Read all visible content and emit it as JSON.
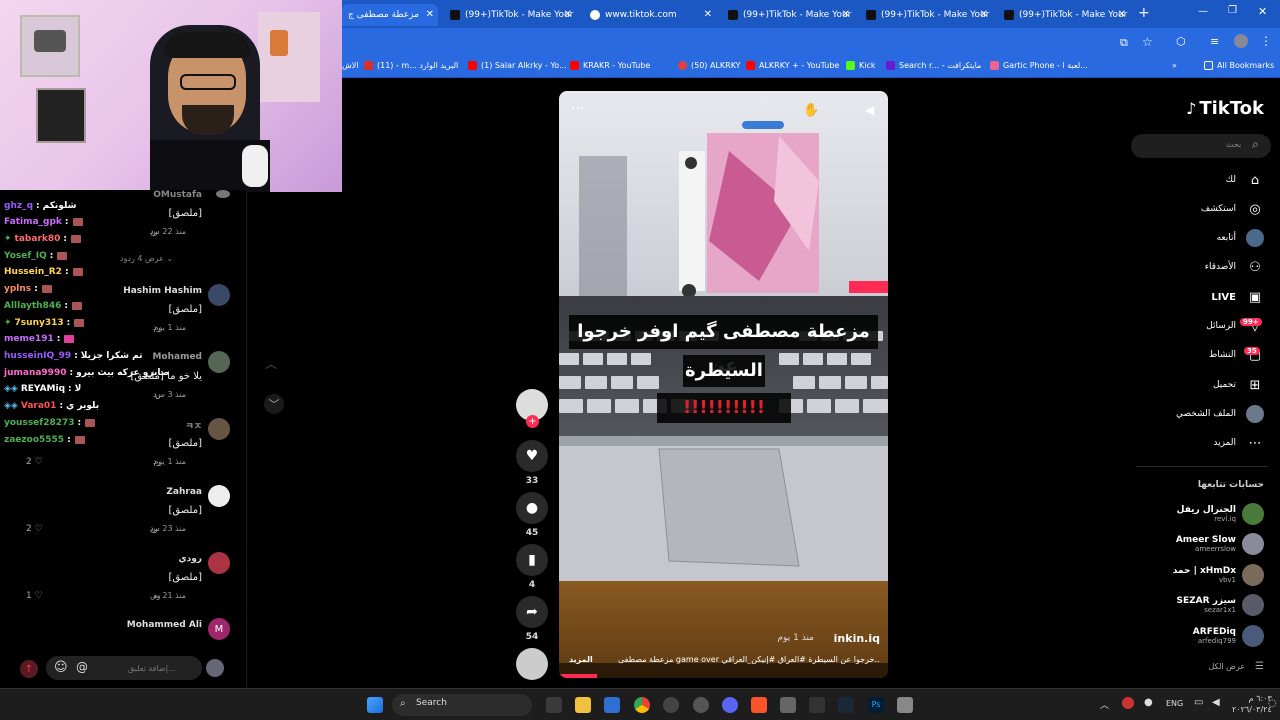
{
  "browser": {
    "tabs": [
      {
        "label": "مزعطة مصطفى ج",
        "active": true
      },
      {
        "label": "(99+)TikTok - Make Your"
      },
      {
        "label": "www.tiktok.com"
      },
      {
        "label": "(99+)TikTok - Make Your"
      },
      {
        "label": "(99+)TikTok - Make Your"
      },
      {
        "label": "(99+)TikTok - Make Your"
      }
    ],
    "new_tab": "+",
    "bookmarks": [
      {
        "label": "(11) - m... البريد الوارد",
        "color": "#d93025"
      },
      {
        "label": "(1) Salar Alkrky - Yo...",
        "color": "#ff0000"
      },
      {
        "label": "KRAKR - YouTube",
        "color": "#ff0000"
      },
      {
        "label": "(50) ALKRKY",
        "color": "#e04040"
      },
      {
        "label": "ALKRKY + - YouTube",
        "color": "#ff0000"
      },
      {
        "label": "Kick",
        "color": "#53fc18"
      },
      {
        "label": "Search r... - مايتكرافت",
        "color": "#6a1bd1"
      },
      {
        "label": "Gartic Phone - لعبة ا...",
        "color": "#f06292"
      }
    ],
    "bookmarks_more": "»",
    "all_bookmarks": "All Bookmarks",
    "bookmark_left_partial": "الاش"
  },
  "chat": {
    "top_partial_name": "OMustafa",
    "lines": [
      {
        "user": "ghz_q",
        "msg": "شلونكم",
        "color": "#9b59ff"
      },
      {
        "user": "Fatima_gpk",
        "msg": "",
        "color": "#c86bff"
      },
      {
        "user": "tabark80",
        "msg": "",
        "color": "#ff6b6b"
      },
      {
        "user": "Yosef_IQ",
        "msg": "",
        "color": "#4caf50"
      },
      {
        "user": "Hussein_R2",
        "msg": "",
        "color": "#ffd54f"
      },
      {
        "user": "yplns",
        "msg": "",
        "color": "#ff8a65"
      },
      {
        "user": "Alllayth846",
        "msg": "",
        "color": "#4caf50"
      },
      {
        "user": "7suny313",
        "msg": "",
        "color": "#ffd54f"
      },
      {
        "user": "meme191",
        "msg": "",
        "color": "#c86bff"
      },
      {
        "user": "husseinIQ_99",
        "msg": "تم شكرا جزيلا",
        "color": "#9b59ff"
      },
      {
        "user": "jumana9990",
        "msg": "صايرو عركه بيث بيرو",
        "color": "#ff6bcb"
      },
      {
        "user": "REYAMiq",
        "msg": "لا",
        "color": "#4fc3f7"
      },
      {
        "user": "Vara01",
        "msg": "بلوبر ي",
        "color": "#ff5252"
      },
      {
        "user": "youssef28273",
        "msg": "",
        "color": "#4caf50"
      },
      {
        "user": "zaezoo5555",
        "msg": "",
        "color": "#4caf50"
      }
    ],
    "comments": [
      {
        "name": "",
        "body": "[ملصق]",
        "time": "منذ 22 س",
        "reply": "رد"
      },
      {
        "name": "Hashim Hashim",
        "body": "[ملصق]",
        "time": "منذ 1 يوم",
        "reply": "رد"
      },
      {
        "name": "Mohamed",
        "body": "[ملصق] يلا خو ما",
        "time": "منذ 3 س",
        "reply": "رد"
      },
      {
        "name": "ㅋㅈ",
        "body": "[ملصق]",
        "time": "منذ 1 يوم",
        "reply": "رد",
        "likes": "2"
      },
      {
        "name": "Zahraa",
        "body": "[ملصق]",
        "time": "منذ 23 س",
        "reply": "رد",
        "likes": "2"
      },
      {
        "name": "رودي",
        "body": "[ملصق]",
        "time": "منذ 21 س",
        "reply": "رد",
        "likes": "1"
      },
      {
        "name": "Mohammed Ali",
        "body": "",
        "time": "",
        "reply": ""
      }
    ],
    "view_replies": "عرض 4 ردود",
    "comment_placeholder": "إضافة تعليق...",
    "at": "@"
  },
  "video": {
    "caption_line1": "مزعطة مصطفى گيم اوفر خرجوا عن",
    "caption_line2": "السيطرة",
    "caption_line3": "!!!!!!!!!!",
    "author": "inkin.iq",
    "time": "منذ 1 يوم",
    "desc": "مزعطة مصطفى game over خرجوا عن السيطرة #العراق #إنيكن_العراقي...",
    "more": "المزيد"
  },
  "actions": {
    "likes": "33",
    "comments": "45",
    "saves": "4",
    "shares": "54"
  },
  "tiktok": {
    "logo": "TikTok",
    "search_placeholder": "بحث",
    "nav": [
      {
        "label": "لك",
        "icon": "home-icon"
      },
      {
        "label": "استكشف",
        "icon": "compass-icon"
      },
      {
        "label": "أتابعه",
        "icon": "following-avatar-icon"
      },
      {
        "label": "الأصدقاء",
        "icon": "friends-icon"
      },
      {
        "label": "LIVE",
        "icon": "live-icon"
      },
      {
        "label": "الرسائل",
        "icon": "messages-icon",
        "badge": "99+"
      },
      {
        "label": "النشاط",
        "icon": "activity-icon",
        "badge": "35"
      },
      {
        "label": "تحميل",
        "icon": "upload-icon"
      },
      {
        "label": "الملف الشخصي",
        "icon": "profile-icon"
      },
      {
        "label": "المزيد",
        "icon": "more-icon"
      }
    ],
    "following_title": "حسابات تتابعها",
    "following": [
      {
        "name": "الجنرال ريفل",
        "handle": "revl.iq"
      },
      {
        "name": "Ameer Slow",
        "handle": "ameerrslow"
      },
      {
        "name": "حمد | xHmDx",
        "handle": "vbv1"
      },
      {
        "name": "SEZAR سيزر",
        "handle": "sezar1x1"
      },
      {
        "name": "ARFEDiq",
        "handle": "arfediq799"
      }
    ],
    "see_all": "عرض الكل"
  },
  "taskbar": {
    "search": "Search",
    "lang": "ENG",
    "time": "٦:٠٣ م",
    "date": "٢٠٢٦/٠٣/٢٤"
  },
  "colors": {
    "tiktok_red": "#fe2c55",
    "chrome_blue": "#2a6ae0"
  }
}
